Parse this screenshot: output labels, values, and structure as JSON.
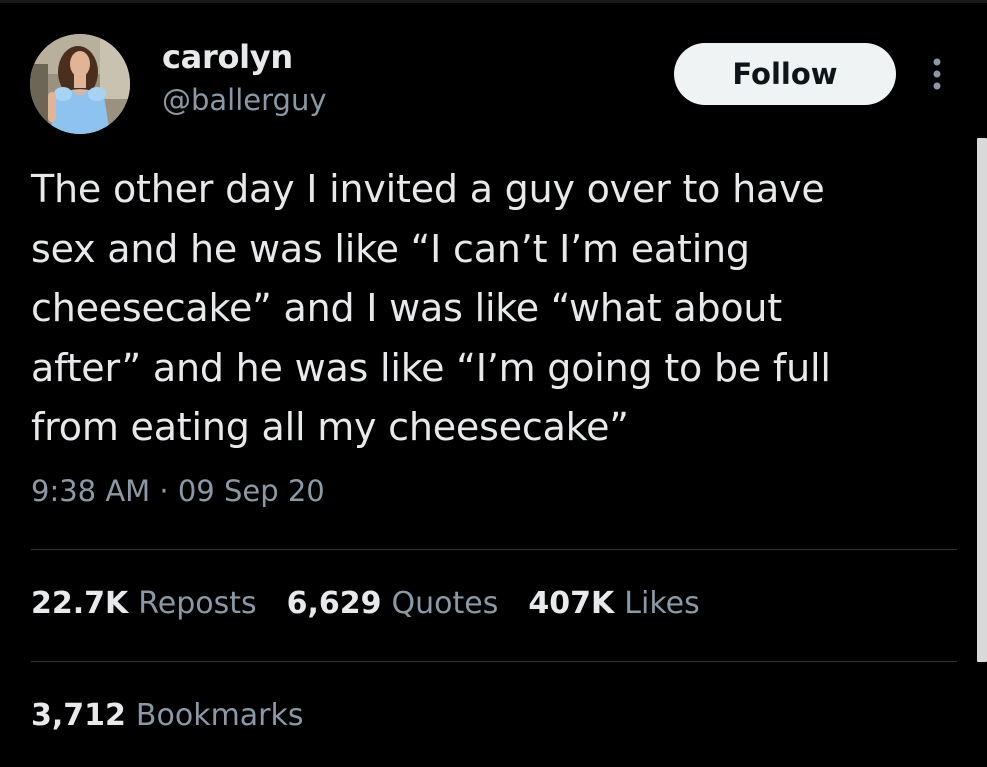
{
  "user": {
    "display_name": "carolyn",
    "handle": "@ballerguy"
  },
  "actions": {
    "follow_label": "Follow",
    "more_icon": "more-vertical-icon"
  },
  "tweet": {
    "text": "The other day I invited a guy over to have\nsex and he was like “I can’t I’m eating\ncheesecake” and I was like “what about\nafter” and he was like “I’m going to be full\nfrom eating all my cheesecake”",
    "timestamp": "9:38 AM · 09 Sep 20"
  },
  "stats": {
    "reposts_value": "22.7K",
    "reposts_label": "Reposts",
    "quotes_value": "6,629",
    "quotes_label": "Quotes",
    "likes_value": "407K",
    "likes_label": "Likes",
    "bookmarks_value": "3,712",
    "bookmarks_label": "Bookmarks"
  },
  "colors": {
    "background": "#000000",
    "primary_text": "#e7e9ea",
    "secondary_text": "#8b98a5",
    "divider": "#2f3336",
    "follow_button_bg": "#eff3f4"
  }
}
